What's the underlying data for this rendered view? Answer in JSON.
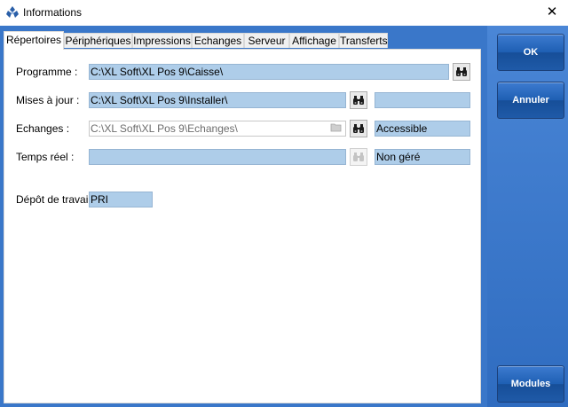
{
  "window": {
    "title": "Informations"
  },
  "tabs": [
    {
      "label": "Répertoires",
      "active": true
    },
    {
      "label": "Périphériques",
      "active": false
    },
    {
      "label": "Impressions",
      "active": false
    },
    {
      "label": "Echanges",
      "active": false
    },
    {
      "label": "Serveur",
      "active": false
    },
    {
      "label": "Affichage",
      "active": false
    },
    {
      "label": "Transferts",
      "active": false
    }
  ],
  "form": {
    "programme": {
      "label": "Programme :",
      "value": "C:\\XL Soft\\XL Pos 9\\Caisse\\"
    },
    "mises_a_jour": {
      "label": "Mises à jour :",
      "value": "C:\\XL Soft\\XL Pos 9\\Installer\\",
      "status": ""
    },
    "echanges": {
      "label": "Echanges :",
      "value": "C:\\XL Soft\\XL Pos 9\\Echanges\\",
      "status": "Accessible"
    },
    "temps_reel": {
      "label": "Temps réel :",
      "value": "",
      "status": "Non géré"
    },
    "depot": {
      "label": "Dépôt de travail :",
      "value": "PRI"
    }
  },
  "side_buttons": {
    "ok": "OK",
    "annuler": "Annuler",
    "modules": "Modules"
  },
  "icons": {
    "app": "app-logo-icon",
    "close": "close-icon",
    "browse": "binoculars-icon",
    "folder": "folder-icon"
  },
  "colors": {
    "frame": "#3a77c9",
    "field": "#aecde9",
    "button": "#1f5aa8"
  }
}
